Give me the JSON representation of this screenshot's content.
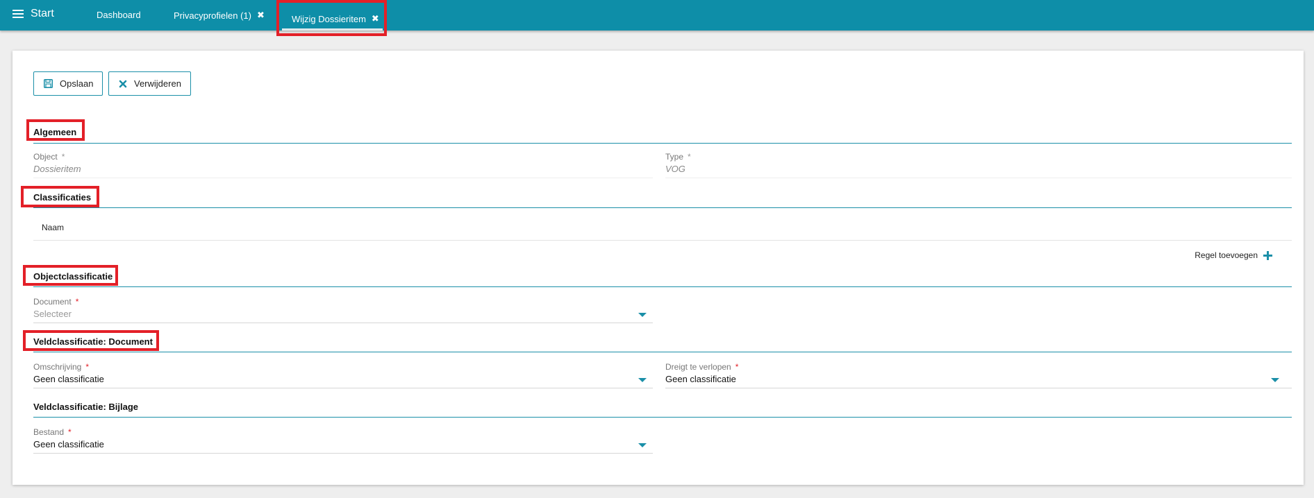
{
  "topbar": {
    "start_label": "Start",
    "tabs": [
      {
        "label": "Dashboard"
      },
      {
        "label": "Privacyprofielen (1)"
      },
      {
        "label": "Wijzig Dossieritem"
      }
    ]
  },
  "toolbar": {
    "save_label": "Opslaan",
    "delete_label": "Verwijderen"
  },
  "sections": {
    "algemeen": {
      "title": "Algemeen",
      "object_label": "Object",
      "object_value": "Dossieritem",
      "type_label": "Type",
      "type_value": "VOG",
      "required_mark": "*"
    },
    "classificaties": {
      "title": "Classificaties",
      "column_naam": "Naam",
      "add_row_label": "Regel toevoegen"
    },
    "objectclassificatie": {
      "title": "Objectclassificatie",
      "document_label": "Document",
      "document_placeholder": "Selecteer"
    },
    "veld_document": {
      "title": "Veldclassificatie: Document",
      "omschrijving_label": "Omschrijving",
      "omschrijving_value": "Geen classificatie",
      "dreigt_label": "Dreigt te verlopen",
      "dreigt_value": "Geen classificatie"
    },
    "veld_bijlage": {
      "title": "Veldclassificatie: Bijlage",
      "bestand_label": "Bestand",
      "bestand_value": "Geen classificatie"
    }
  },
  "colors": {
    "topbar": "#0e8ea8",
    "accent": "#1a8fa8",
    "highlight": "#e32028"
  }
}
